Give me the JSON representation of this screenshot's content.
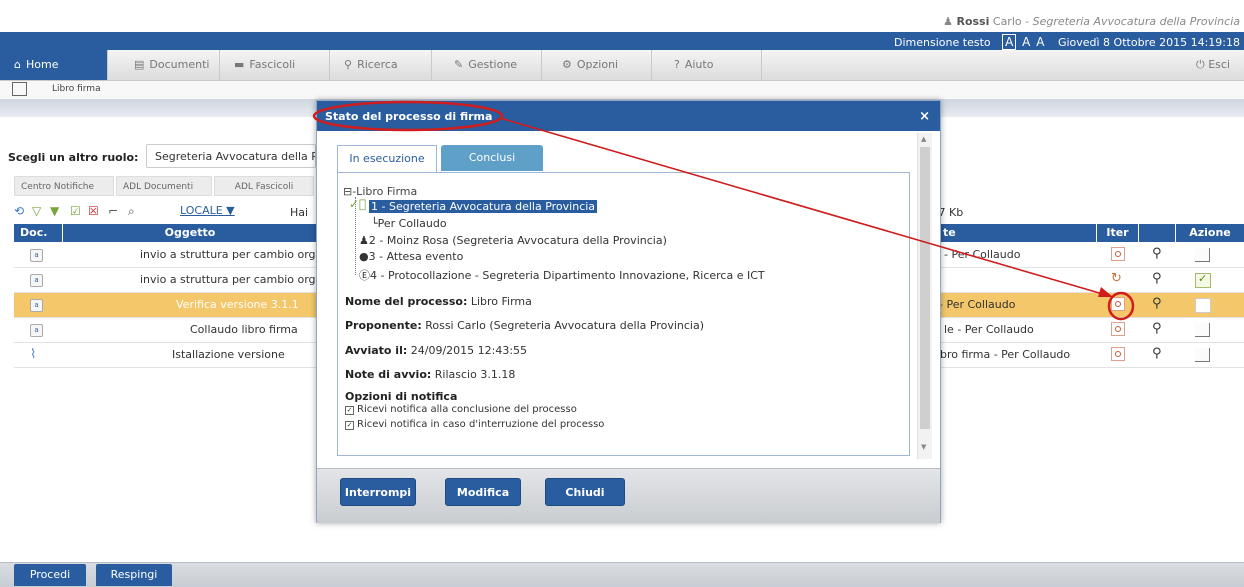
{
  "header": {
    "user_name": "Rossi",
    "user_first": "Carlo",
    "user_office": "Segreteria Avvocatura della Provincia",
    "text_size_label": "Dimensione testo",
    "text_size_options": [
      "A",
      "A",
      "A"
    ],
    "datetime": "Giovedì 8 Ottobre 2015 14:19:18"
  },
  "nav": {
    "tabs": [
      {
        "label": "Home",
        "icon": "home-icon"
      },
      {
        "label": "Documenti",
        "icon": "document-icon"
      },
      {
        "label": "Fascicoli",
        "icon": "folder-icon"
      },
      {
        "label": "Ricerca",
        "icon": "search-icon"
      },
      {
        "label": "Gestione",
        "icon": "pencil-icon"
      },
      {
        "label": "Opzioni",
        "icon": "options-icon"
      },
      {
        "label": "Aiuto",
        "icon": "help-icon"
      }
    ],
    "logout_label": "Esci"
  },
  "breadcrumb": {
    "label": "Libro firma"
  },
  "role": {
    "label": "Scegli un altro ruolo:",
    "value": "Segreteria Avvocatura della Pr"
  },
  "subtabs": [
    "Centro Notifiche",
    "ADL Documenti",
    "ADL Fascicoli"
  ],
  "toolbar": {
    "locale_label": "LOCALE ▼",
    "hai_text": "Hai",
    "size_text": ".7 Kb"
  },
  "table": {
    "headers": {
      "doc": "Doc.",
      "oggetto": "Oggetto",
      "te": "te",
      "iter": "Iter",
      "azione": "Azione"
    },
    "rows": [
      {
        "oggetto": "invio a struttura per cambio orga",
        "note": "- Per Collaudo"
      },
      {
        "oggetto": "invio a struttura per cambio orga",
        "note": ""
      },
      {
        "oggetto": "Verifica versione 3.1.1",
        "note": "- Per Collaudo"
      },
      {
        "oggetto": "Collaudo libro firma",
        "note": "le - Per Collaudo"
      },
      {
        "oggetto": "Istallazione versione",
        "note": "bro firma - Per Collaudo"
      }
    ]
  },
  "bottom": {
    "procedi_label": "Procedi",
    "respingi_label": "Respingi"
  },
  "modal": {
    "title": "Stato del processo di firma",
    "close_label": "×",
    "tab_running": "In esecuzione",
    "tab_done": "Conclusi",
    "tree_root": "⊟-Libro Firma",
    "tree_step1": "1 - Segreteria Avvocatura della Provincia",
    "tree_step1_sub": "Per Collaudo",
    "tree_step2": "2 - Moinz  Rosa (Segreteria Avvocatura della Provincia)",
    "tree_step3": "3 - Attesa evento",
    "tree_step4": "4 - Protocollazione - Segreteria Dipartimento Innovazione, Ricerca e ICT",
    "process_name_label": "Nome del processo:",
    "process_name_value": "Libro Firma",
    "proposer_label": "Proponente:",
    "proposer_value": "Rossi Carlo (Segreteria Avvocatura della Provincia)",
    "started_label": "Avviato il:",
    "started_value": "24/09/2015 12:43:55",
    "notes_label": "Note di avvio:",
    "notes_value": "Rilascio 3.1.18",
    "notify_title": "Opzioni di notifica",
    "notify_opt1": "Ricevi notifica alla conclusione del processo",
    "notify_opt2": "Ricevi notifica in caso d'interruzione del processo",
    "btn_interrompi": "Interrompi",
    "btn_modifica": "Modifica",
    "btn_chiudi": "Chiudi"
  },
  "colors": {
    "brand_blue": "#2a5d9f",
    "highlight_row": "#f3c76a",
    "annotation_red": "#d01c1c"
  }
}
